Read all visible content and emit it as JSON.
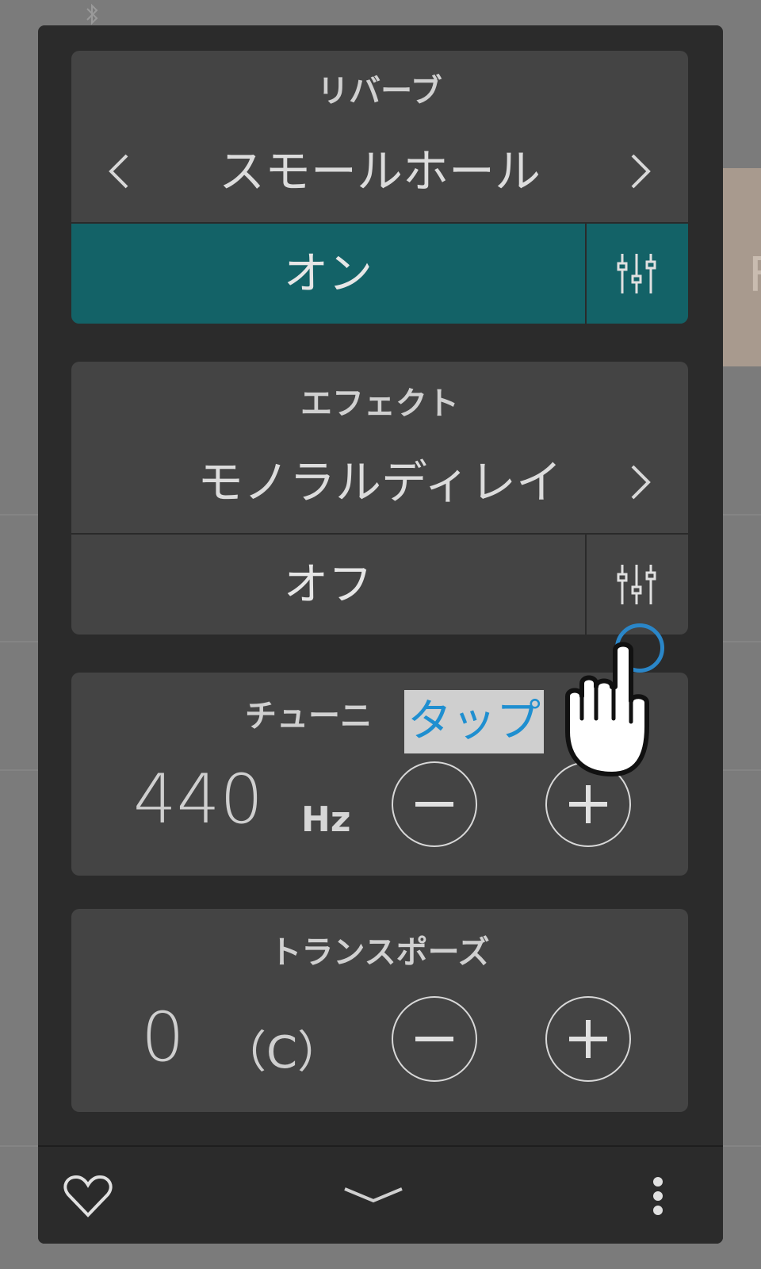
{
  "reverb": {
    "title": "リバーブ",
    "type": "スモールホール",
    "state": "オン",
    "is_on": true
  },
  "effect": {
    "title": "エフェクト",
    "type": "モノラルディレイ",
    "state": "オフ",
    "is_on": false
  },
  "tune": {
    "title": "チューニ",
    "value": "440",
    "unit": "Hz"
  },
  "transpose": {
    "title": "トランスポーズ",
    "value": "0",
    "key": "（C）"
  },
  "tap_hint": {
    "label": "タップ"
  },
  "icons": {
    "prev": "chevron-left-icon",
    "next": "chevron-right-icon",
    "settings": "sliders-icon",
    "minus": "minus-icon",
    "plus": "plus-icon",
    "favorite": "heart-icon",
    "collapse": "chevron-down-icon",
    "more": "more-vertical-icon"
  },
  "colors": {
    "on_accent": "#136267",
    "tap_ring": "#2a86c8",
    "tap_text": "#1f8fd0"
  }
}
